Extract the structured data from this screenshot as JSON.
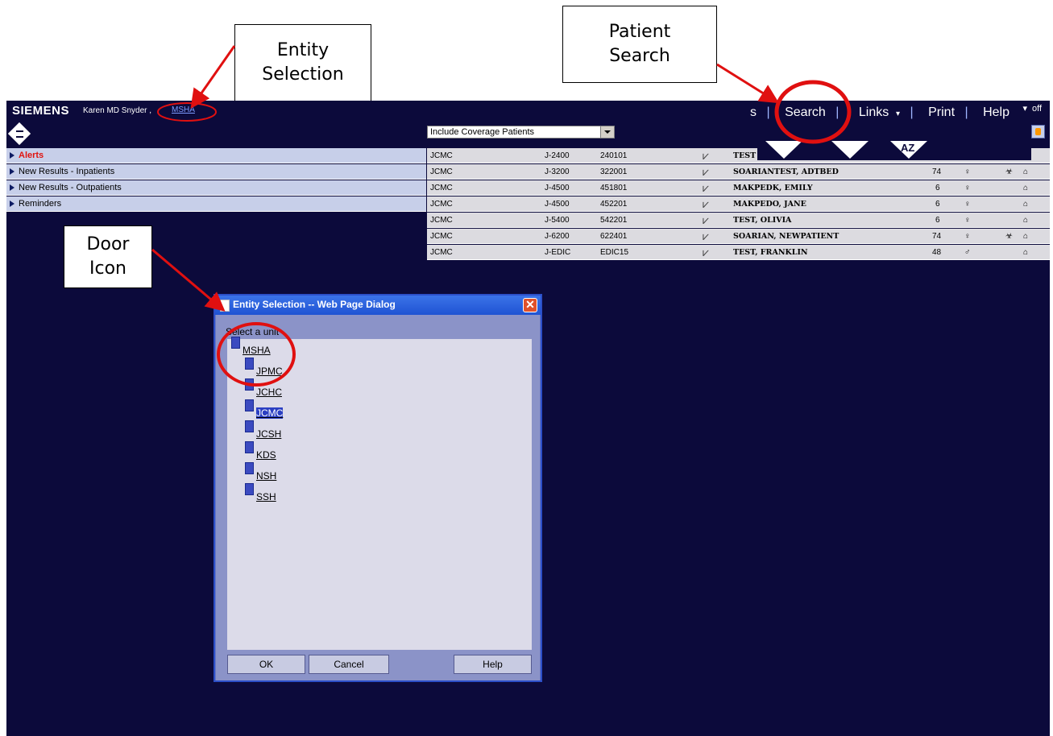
{
  "callouts": {
    "entity_selection": "Entity\nSelection",
    "patient_search": "Patient\nSearch",
    "door_icon": "Door\nIcon"
  },
  "app": {
    "brand": "SIEMENS",
    "user": "Karen MD Snyder ,",
    "entity_link": "MSHA",
    "nav": {
      "truncated": "s",
      "search": "Search",
      "links": "Links",
      "print": "Print",
      "help": "Help",
      "logoff": "off"
    }
  },
  "worklist_sections": [
    {
      "label": "Alerts"
    },
    {
      "label": "New Results - Inpatients"
    },
    {
      "label": "New Results - Outpatients"
    },
    {
      "label": "Reminders"
    }
  ],
  "patient_list": {
    "filter_value": "Include Coverage Patients",
    "sort_label": "AZ",
    "rows": [
      {
        "facility": "JCMC",
        "unit": "J-2400",
        "room": "240101",
        "name": "TEST",
        "age": "",
        "sex": "",
        "bio": false
      },
      {
        "facility": "JCMC",
        "unit": "J-3200",
        "room": "322001",
        "name": "SOARIANTEST, ADTBED",
        "age": "74",
        "sex": "♀",
        "bio": true
      },
      {
        "facility": "JCMC",
        "unit": "J-4500",
        "room": "451801",
        "name": "MAKPEDK, EMILY",
        "age": "6",
        "sex": "♀",
        "bio": false
      },
      {
        "facility": "JCMC",
        "unit": "J-4500",
        "room": "452201",
        "name": "MAKPEDO, JANE",
        "age": "6",
        "sex": "♀",
        "bio": false
      },
      {
        "facility": "JCMC",
        "unit": "J-5400",
        "room": "542201",
        "name": "TEST, OLIVIA",
        "age": "6",
        "sex": "♀",
        "bio": false
      },
      {
        "facility": "JCMC",
        "unit": "J-6200",
        "room": "622401",
        "name": "SOARIAN, NEWPATIENT",
        "age": "74",
        "sex": "♀",
        "bio": true
      },
      {
        "facility": "JCMC",
        "unit": "J-EDIC",
        "room": "EDIC15",
        "name": "TEST, FRANKLIN",
        "age": "48",
        "sex": "♂",
        "bio": false
      }
    ]
  },
  "dialog": {
    "title": "Entity Selection -- Web Page Dialog",
    "prompt": "Select a unit",
    "tree": [
      {
        "label": "MSHA",
        "level": 0,
        "selected": false
      },
      {
        "label": "JPMC",
        "level": 1,
        "selected": false
      },
      {
        "label": "JCHC",
        "level": 1,
        "selected": false
      },
      {
        "label": "JCMC",
        "level": 1,
        "selected": true
      },
      {
        "label": "JCSH",
        "level": 1,
        "selected": false
      },
      {
        "label": "KDS",
        "level": 1,
        "selected": false
      },
      {
        "label": "NSH",
        "level": 1,
        "selected": false
      },
      {
        "label": "SSH",
        "level": 1,
        "selected": false
      }
    ],
    "buttons": {
      "ok": "OK",
      "cancel": "Cancel",
      "help": "Help"
    }
  },
  "colors": {
    "app_bg": "#0c0a3b",
    "section_bg": "#c7cfe9",
    "alert_text": "#e0140f",
    "annotation_red": "#e01010"
  }
}
